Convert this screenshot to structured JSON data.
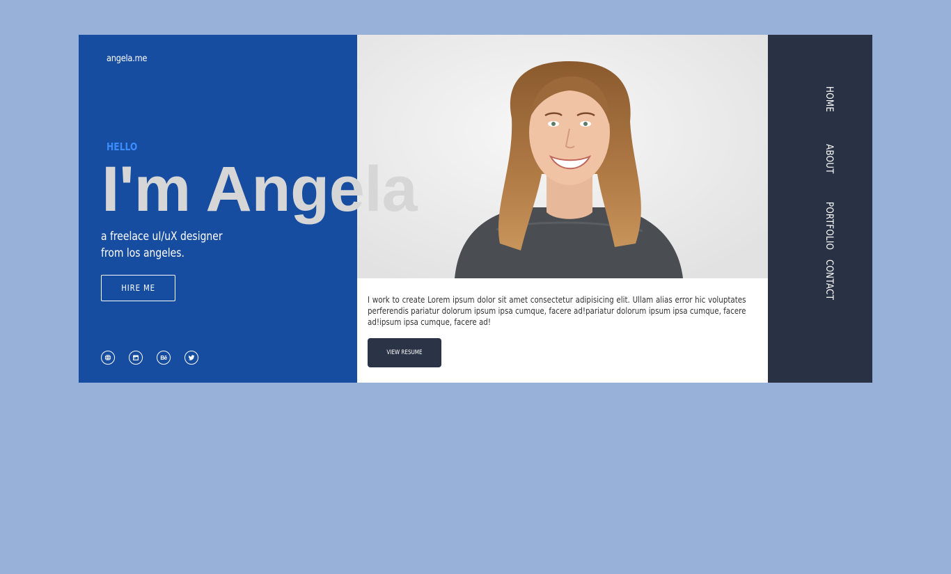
{
  "brand": {
    "logo": "angela.me"
  },
  "hero": {
    "greeting": "HELLO",
    "name": "I'm Angela",
    "tagline_line1": "a freelace uI/uX designer",
    "tagline_line2": "from los angeles.",
    "hire_label": "HIRE ME"
  },
  "socials": [
    {
      "icon": "globe-icon"
    },
    {
      "icon": "calendar-icon"
    },
    {
      "icon": "behance-icon",
      "glyph": "Bē"
    },
    {
      "icon": "twitter-icon"
    }
  ],
  "about": {
    "description": "I work to create Lorem ipsum dolor sit amet consectetur adipisicing elit. Ullam alias error hic voluptates perferendis pariatur dolorum ipsum ipsa cumque, facere ad!pariatur dolorum ipsum ipsa cumque, facere ad!ipsum ipsa cumque, facere ad!",
    "resume_label": "VIEW RESUME"
  },
  "nav": {
    "home": "HOME",
    "about": "ABOUT",
    "portfolio": "PORTFOLIO",
    "contact": "CONTACT"
  },
  "colors": {
    "page_bg": "#98b1d9",
    "left_panel": "#174da0",
    "accent": "#3b8cff",
    "nav_panel": "#293244",
    "button_dark": "#2b3446"
  }
}
